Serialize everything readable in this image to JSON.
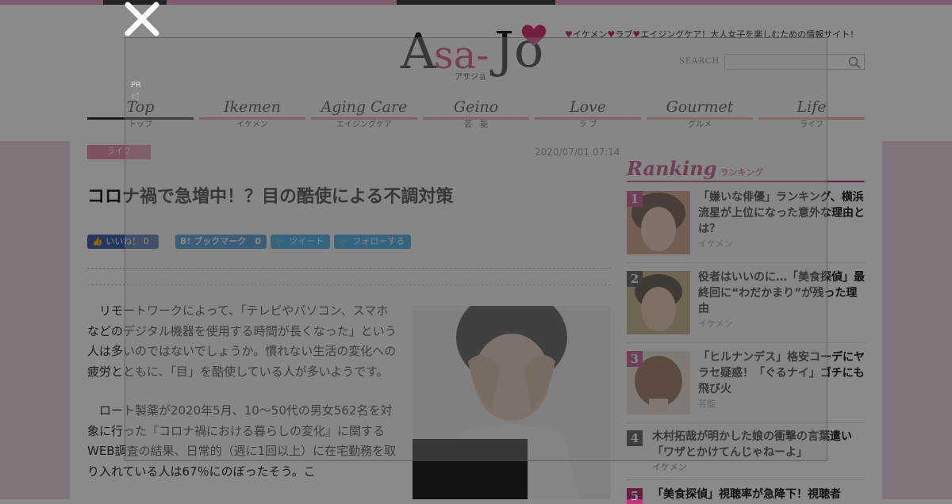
{
  "site": {
    "tagline_parts": [
      "イケメン",
      "ラブ",
      "エイジングケア！大人女子を楽しむための情報サイト！"
    ],
    "logo": {
      "text": "Asa-Jo",
      "ruby": "アサジョ"
    },
    "search_label": "SEARCH",
    "search_placeholder": "",
    "colors": {
      "accent": "#c1357a",
      "logo_pink": "#d8347a",
      "nav_active": "#333333",
      "nav_line": "#e79ab9",
      "facebook": "#4267b2",
      "hatena": "#2a8fd7",
      "twitter": "#1da1f2"
    }
  },
  "nav": [
    {
      "en": "Top",
      "jp": "トップ",
      "active": true
    },
    {
      "en": "Ikemen",
      "jp": "イケメン"
    },
    {
      "en": "Aging Care",
      "jp": "エイジングケア"
    },
    {
      "en": "Geino",
      "jp": "芸　能"
    },
    {
      "en": "Love",
      "jp": "ラ ブ"
    },
    {
      "en": "Gourmet",
      "jp": "グルメ"
    },
    {
      "en": "Life",
      "jp": "ライフ"
    }
  ],
  "article": {
    "category": "ライフ",
    "date": "2020/07/01 07:14",
    "title": "コロナ禍で急増中！？目の酷使による不調対策",
    "share": {
      "like": "いいね！ 0",
      "bookmark": "B! ブックマーク　0",
      "tweet": "ツイート",
      "follow": "フォローする"
    },
    "paragraphs": [
      "　リモートワークによって、「テレビやパソコン、スマホなどのデジタル機器を使用する時間が長くなった」という人は多いのではないでしょうか。慣れない生活の変化への疲労とともに、「目」を酷使している人が多いようです。",
      "　ロート製薬が2020年5月、10～50代の男女562名を対象に行った『コロナ禍における暮らしの変化』に関するWEB調査の結果、日常的（週に1回以上）に在宅勤務を取り入れている人は67％にのぼったそう。こ"
    ],
    "image_icon": "woman-rubbing-eyes-photo"
  },
  "ranking": {
    "title": "Ranking",
    "title_jp": "ランキング",
    "items": [
      {
        "num": "1",
        "title": "「嫌いな俳優」ランキング、横浜流星が上位になった意外な理由とは？",
        "cat": "イケメン",
        "thumb": "actor-portrait-1"
      },
      {
        "num": "2",
        "title": "役者はいいのに…「美食探偵」最終回に“わだかまり”が残った理由",
        "cat": "イケメン",
        "thumb": "actor-portrait-2"
      },
      {
        "num": "3",
        "title": "「ヒルナンデス」格安コーデにヤラセ疑惑！「ぐるナイ」ゴチにも飛び火",
        "cat": "芸能",
        "thumb": "hairstyle-back-photo"
      },
      {
        "num": "4",
        "title": "木村拓哉が明かした娘の衝撃の言葉遣い「ワザとかけてんじゃねーよ」",
        "cat": "イケメン"
      },
      {
        "num": "5",
        "title": "「美食探偵」視聴率が急降下！視聴者"
      }
    ]
  },
  "ad_overlay": {
    "pr_label": "PR",
    "close_icon": "close-x-icon"
  }
}
